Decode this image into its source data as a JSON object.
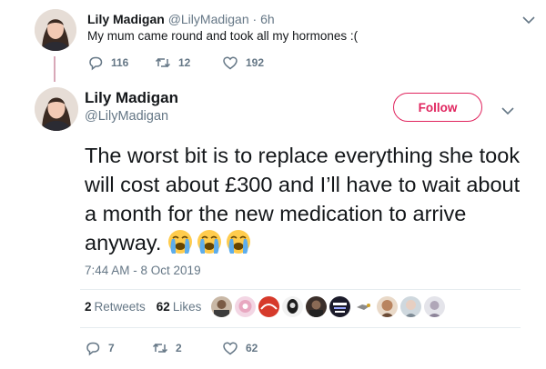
{
  "parent_tweet": {
    "name": "Lily Madigan",
    "handle": "@LilyMadigan",
    "separator": "·",
    "time": "6h",
    "text": "My mum came round and took all my hormones :(",
    "replies": "116",
    "retweets": "12",
    "likes": "192",
    "icons": [
      "reply-icon",
      "retweet-icon",
      "like-icon",
      "caret-down-icon"
    ]
  },
  "main_tweet": {
    "name": "Lily Madigan",
    "handle": "@LilyMadigan",
    "follow_label": "Follow",
    "text": "The worst bit is to replace everything she took will cost about £300 and I’ll have to wait about a month for the new medication to arrive anyway.",
    "emoji": [
      "loudly-crying-face",
      "loudly-crying-face",
      "loudly-crying-face"
    ],
    "timestamp": "7:44 AM - 8 Oct 2019",
    "retweet_count": "2",
    "retweet_label": "Retweets",
    "like_count": "62",
    "like_label": "Likes",
    "replies": "7",
    "retweets": "2",
    "likes": "62",
    "liker_avatar_count": 10
  },
  "colors": {
    "text": "#14171a",
    "muted": "#657786",
    "follow_accent": "#e0245e",
    "thread_line": "#d8a8b8",
    "divider": "#e6ecf0"
  }
}
